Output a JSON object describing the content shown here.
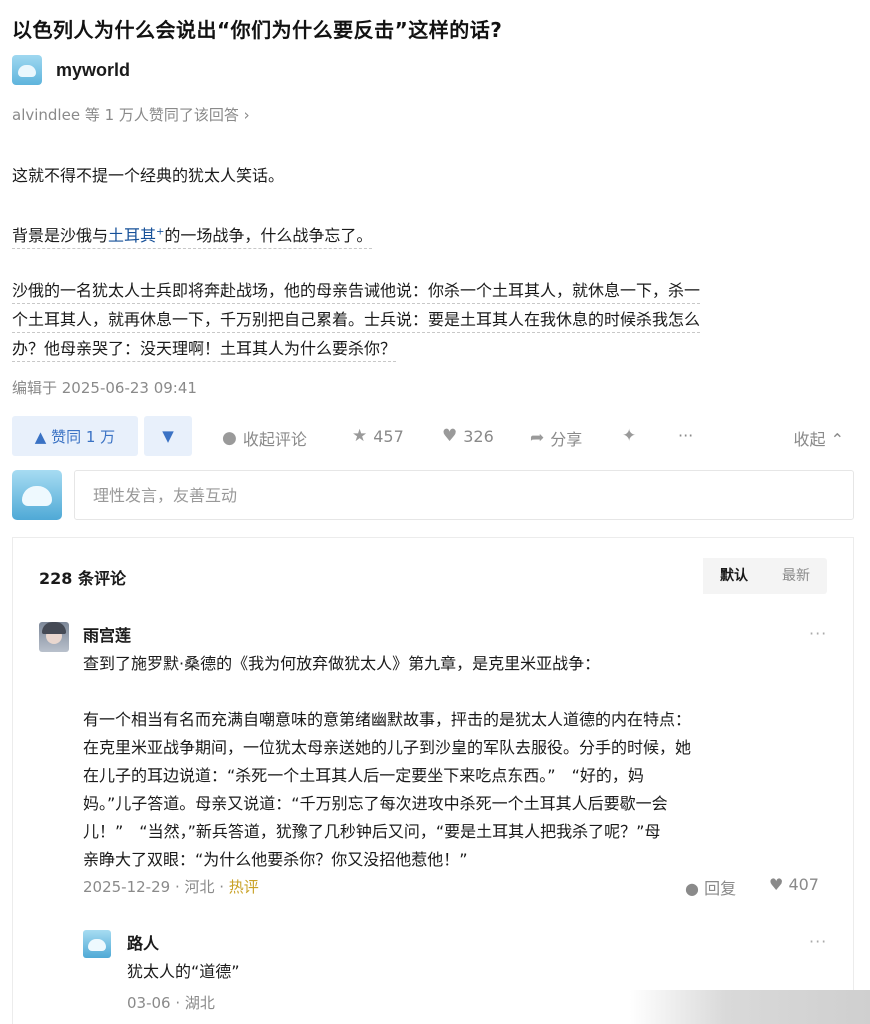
{
  "question": {
    "title": "以色列人为什么会说出“你们为什么要反击”这样的话?"
  },
  "answer": {
    "author": "myworld",
    "likers_text": "alvindlee 等 1 万人赞同了该回答 ›",
    "p1": "这就不得不提一个经典的犹太人笑话。",
    "p2_pre": "背景是沙俄与",
    "p2_link": "土耳其",
    "p2_plus": "+",
    "p2_post": "的一场战争，什么战争忘了。",
    "p3_l1": "沙俄的一名犹太人士兵即将奔赴战场，他的母亲告诫他说：你杀一个土耳其人，就休息一下，杀一",
    "p3_l2": "个土耳其人，就再休息一下，千万别把自己累着。士兵说：要是土耳其人在我休息的时候杀我怎么",
    "p3_l3": "办？他母亲哭了：没天理啊！土耳其人为什么要杀你？",
    "edited": "编辑于 2025-06-23 09:41"
  },
  "actions": {
    "upvote": "▲ 赞同 1 万",
    "downvote": "▼",
    "collapse_comments": "收起评论",
    "favorites": "457",
    "likes": "326",
    "share": "分享",
    "more": "···",
    "collapse": "收起 ⌃"
  },
  "reply": {
    "placeholder": "理性发言，友善互动"
  },
  "comments": {
    "count_label": "228 条评论",
    "sort_default": "默认",
    "sort_latest": "最新",
    "items": [
      {
        "name": "雨宫莲",
        "lines": [
          "查到了施罗默·桑德的《我为何放弃做犹太人》第九章，是克里米亚战争：",
          "",
          "有一个相当有名而充满自嘲意味的意第绪幽默故事，抨击的是犹太人道德的内在特点：",
          "在克里米亚战争期间，一位犹太母亲送她的儿子到沙皇的军队去服役。分手的时候，她",
          "在儿子的耳边说道：“杀死一个土耳其人后一定要坐下来吃点东西。”　“好的，妈",
          "妈。”儿子答道。母亲又说道：“千万别忘了每次进攻中杀死一个土耳其人后要歇一会",
          "儿！”　“当然，”新兵答道，犹豫了几秒钟后又问，“要是土耳其人把我杀了呢？”母",
          "亲睁大了双眼：“为什么他要杀你？你又没招他惹他！”"
        ],
        "date": "2025-12-29",
        "loc": " · 河北 · ",
        "hot": "热评",
        "reply_label": "回复",
        "likes": "407",
        "more": "···"
      },
      {
        "name": "路人",
        "text": "犹太人的“道德”",
        "date": "03-06",
        "loc": " · 湖北",
        "more": "···"
      }
    ]
  }
}
